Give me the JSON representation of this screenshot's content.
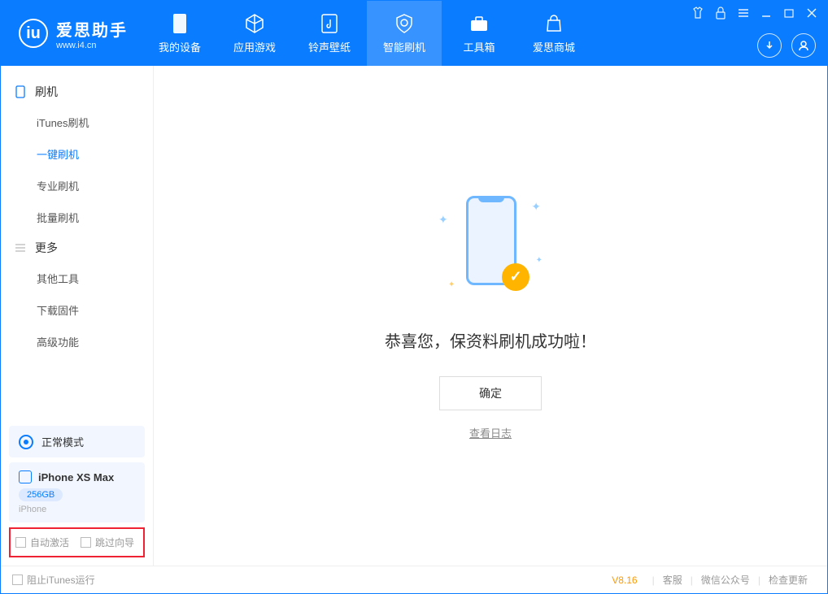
{
  "app": {
    "name": "爱思助手",
    "url": "www.i4.cn"
  },
  "nav": {
    "tabs": [
      {
        "label": "我的设备"
      },
      {
        "label": "应用游戏"
      },
      {
        "label": "铃声壁纸"
      },
      {
        "label": "智能刷机"
      },
      {
        "label": "工具箱"
      },
      {
        "label": "爱思商城"
      }
    ]
  },
  "sidebar": {
    "section1": {
      "title": "刷机"
    },
    "items1": [
      {
        "label": "iTunes刷机"
      },
      {
        "label": "一键刷机"
      },
      {
        "label": "专业刷机"
      },
      {
        "label": "批量刷机"
      }
    ],
    "section2": {
      "title": "更多"
    },
    "items2": [
      {
        "label": "其他工具"
      },
      {
        "label": "下载固件"
      },
      {
        "label": "高级功能"
      }
    ]
  },
  "mode": {
    "label": "正常模式"
  },
  "device": {
    "name": "iPhone XS Max",
    "capacity": "256GB",
    "type": "iPhone"
  },
  "options": {
    "autoActivate": "自动激活",
    "skipGuide": "跳过向导"
  },
  "main": {
    "successText": "恭喜您，保资料刷机成功啦！",
    "okButton": "确定",
    "viewLog": "查看日志"
  },
  "footer": {
    "blockItunes": "阻止iTunes运行",
    "version": "V8.16",
    "links": [
      "客服",
      "微信公众号",
      "检查更新"
    ]
  }
}
